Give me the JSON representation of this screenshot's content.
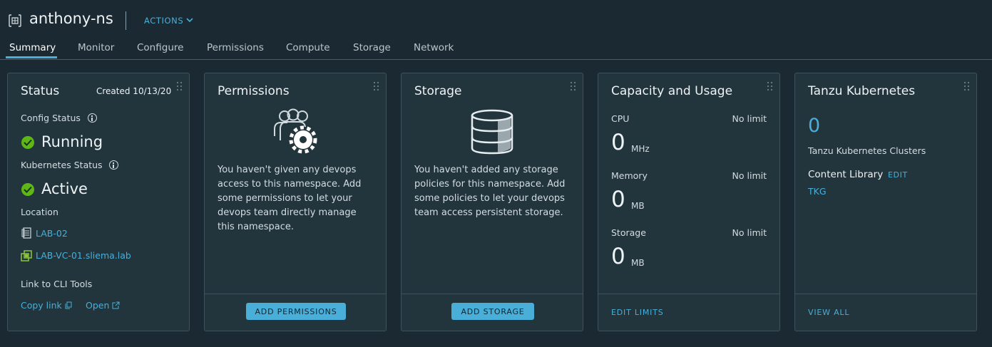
{
  "header": {
    "namespace": "anthony-ns",
    "actions_label": "ACTIONS",
    "icon": "namespace-icon"
  },
  "tabs": [
    {
      "label": "Summary",
      "active": true
    },
    {
      "label": "Monitor"
    },
    {
      "label": "Configure"
    },
    {
      "label": "Permissions"
    },
    {
      "label": "Compute"
    },
    {
      "label": "Storage"
    },
    {
      "label": "Network"
    }
  ],
  "status_card": {
    "title": "Status",
    "created": "Created 10/13/20",
    "config_status_label": "Config Status",
    "config_status_value": "Running",
    "k8s_status_label": "Kubernetes Status",
    "k8s_status_value": "Active",
    "location_label": "Location",
    "location_datacenter": "LAB-02",
    "location_vcenter": "LAB-VC-01.sliema.lab",
    "cli_label": "Link to CLI Tools",
    "copy_link": "Copy link",
    "open_link": "Open"
  },
  "permissions_card": {
    "title": "Permissions",
    "message": "You haven't given any devops access to this namespace. Add some permissions to let your devops team directly manage this namespace.",
    "button": "ADD PERMISSIONS"
  },
  "storage_card": {
    "title": "Storage",
    "message": "You haven't added any storage policies for this namespace. Add some policies to let your devops team access persistent storage.",
    "button": "ADD STORAGE"
  },
  "capacity_card": {
    "title": "Capacity and Usage",
    "cpu_label": "CPU",
    "cpu_limit": "No limit",
    "cpu_value": "0",
    "cpu_unit": "MHz",
    "memory_label": "Memory",
    "memory_limit": "No limit",
    "memory_value": "0",
    "memory_unit": "MB",
    "storage_label": "Storage",
    "storage_limit": "No limit",
    "storage_value": "0",
    "storage_unit": "MB",
    "footer_link": "EDIT LIMITS"
  },
  "tanzu_card": {
    "title": "Tanzu Kubernetes",
    "count": "0",
    "clusters_label": "Tanzu Kubernetes Clusters",
    "content_library_label": "Content Library",
    "edit_link": "EDIT",
    "library_name": "TKG",
    "footer_link": "VIEW ALL"
  },
  "colors": {
    "accent": "#49afd9",
    "background": "#1b2a32",
    "card": "#22343c",
    "success": "#5eb715"
  }
}
